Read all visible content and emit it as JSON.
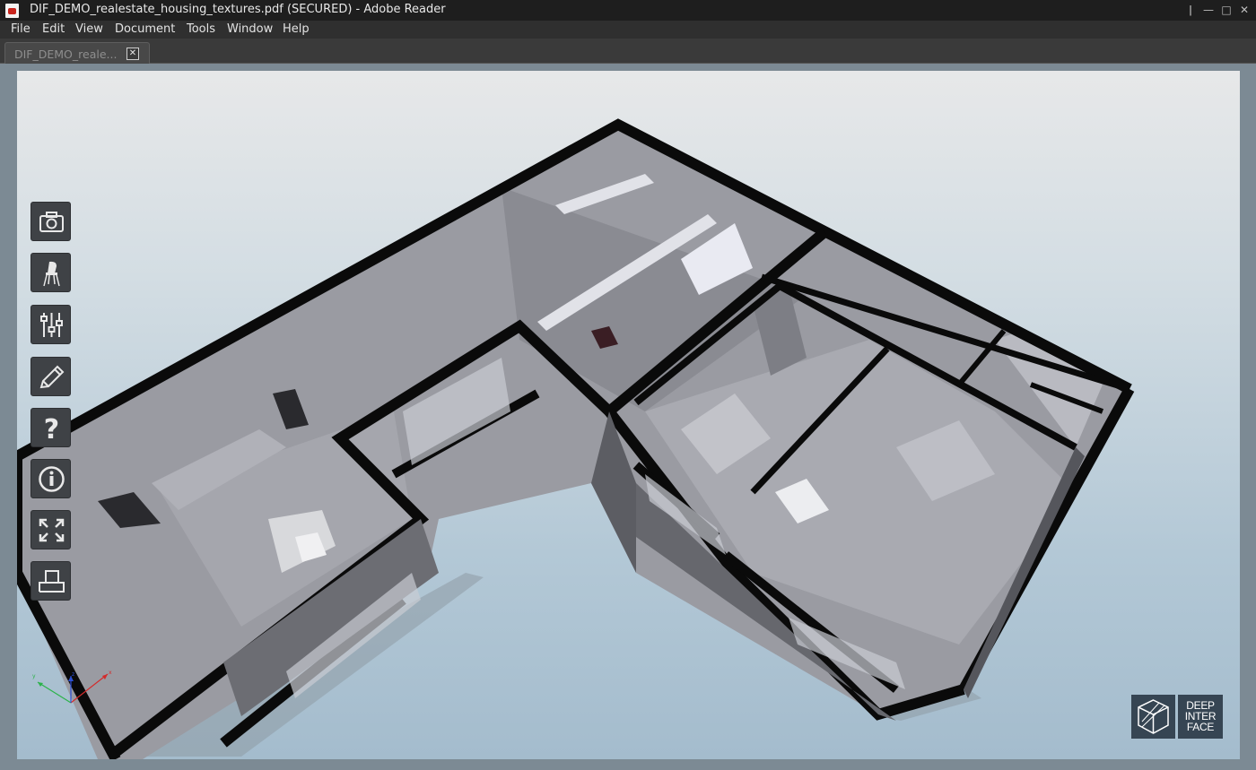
{
  "window": {
    "title": "DIF_DEMO_realestate_housing_textures.pdf (SECURED) - Adobe Reader",
    "controls": [
      "restore-icon",
      "minimize-icon",
      "maximize-icon",
      "close-icon"
    ]
  },
  "menu": {
    "items": [
      {
        "label": "File"
      },
      {
        "label": "Edit"
      },
      {
        "label": "View"
      },
      {
        "label": "Document"
      },
      {
        "label": "Tools"
      },
      {
        "label": "Window"
      },
      {
        "label": "Help"
      }
    ]
  },
  "tabs": [
    {
      "label": "DIF_DEMO_reale...",
      "close": "✕"
    }
  ],
  "viewer": {
    "toolbar": [
      {
        "icon": "camera-icon"
      },
      {
        "icon": "chair-icon"
      },
      {
        "icon": "sliders-icon"
      },
      {
        "icon": "pencil-icon"
      },
      {
        "icon": "question-icon"
      },
      {
        "icon": "info-icon"
      },
      {
        "icon": "fullscreen-icon"
      },
      {
        "icon": "print-icon"
      }
    ],
    "axis_colors": {
      "x": "#d42b2b",
      "y": "#2bb34a",
      "z": "#2b4fd4"
    }
  },
  "logo": {
    "line1": "DEEP",
    "line2": "INTER",
    "line3": "FACE"
  },
  "colors": {
    "titlebar": "#1e1e1e",
    "menubar": "#2f2f2f",
    "doc_background": "#7c8a94",
    "logo_bg": "#364553"
  }
}
